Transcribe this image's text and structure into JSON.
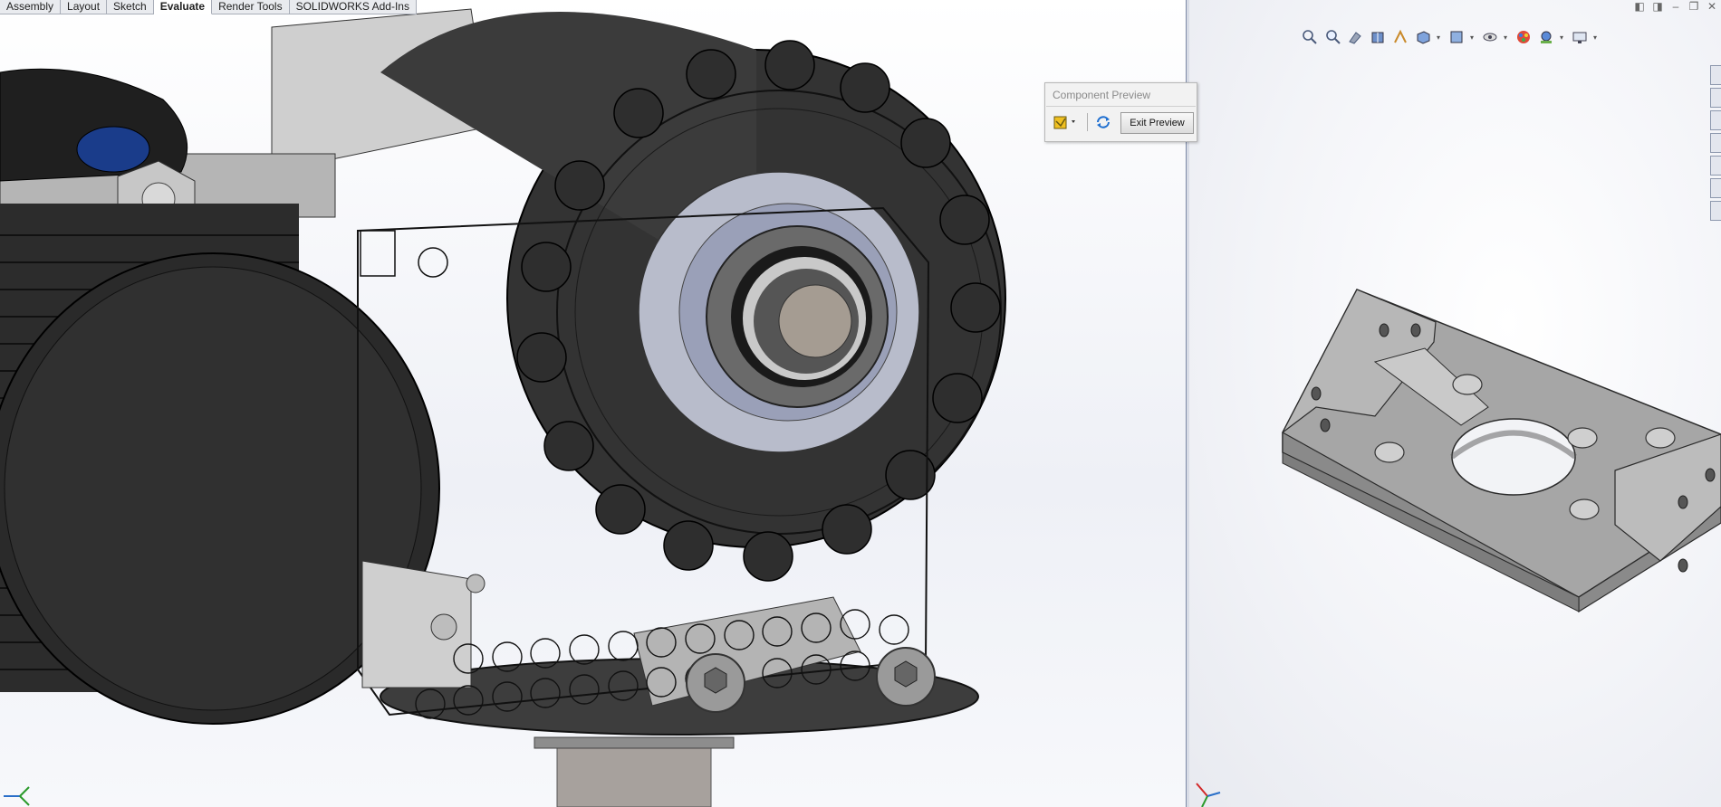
{
  "command_tabs": {
    "items": [
      {
        "label": "Assembly"
      },
      {
        "label": "Layout"
      },
      {
        "label": "Sketch"
      },
      {
        "label": "Evaluate",
        "active": true
      },
      {
        "label": "Render Tools"
      },
      {
        "label": "SOLIDWORKS Add-Ins"
      }
    ]
  },
  "component_preview": {
    "title": "Component Preview",
    "exit_label": "Exit Preview"
  },
  "heads_up_toolbar": {
    "icons": [
      "zoom-to-fit-icon",
      "zoom-to-area-icon",
      "previous-view-icon",
      "section-view-icon",
      "dynamic-annotation-icon",
      "view-orientation-icon",
      "display-style-icon",
      "hide-show-items-icon",
      "edit-appearance-icon",
      "apply-scene-icon",
      "view-settings-icon"
    ]
  },
  "colors": {
    "accent_blue": "#2a6fc9",
    "part_dark": "#3a3a3a",
    "part_gray": "#a9a9a9",
    "triad_red": "#d22828"
  }
}
